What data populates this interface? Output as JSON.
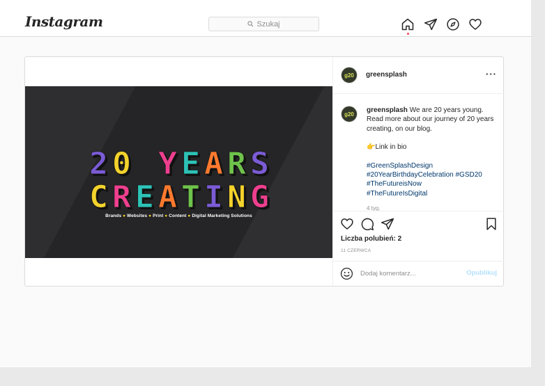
{
  "header": {
    "logo": "Instagram",
    "search": {
      "placeholder": "Szukaj"
    },
    "nav_icons": [
      "home-icon",
      "direct-icon",
      "explore-icon",
      "activity-icon"
    ]
  },
  "post": {
    "username": "greensplash",
    "avatar_text": "g20",
    "more_label": "···",
    "media": {
      "headline_line1": "20 YEARS",
      "headline_line2": "CREATING",
      "tagline_items": [
        "Brands",
        "Websites",
        "Print",
        "Content",
        "Digital Marketing Solutions"
      ],
      "letter_colors": [
        "#7b5bd6",
        "#f3d22b",
        "#ee3f8f",
        "#2cc3b7",
        "#ff7a2e",
        "#6fc24b"
      ]
    },
    "caption": {
      "username": "greensplash",
      "text": "We are 20 years young. Read more about our journey of 20 years creating, on our blog.",
      "link_line": "👉Link in bio",
      "hashtags": [
        "#GreenSplashDesign",
        "#20YearBirthdayCelebration #GSD20",
        "#TheFutureisNow",
        "#TheFutureIsDigital"
      ],
      "time_stub": "4 tyg."
    },
    "likes_label": "Liczba polubień: 2",
    "date": "11 CZERWCA",
    "comment": {
      "placeholder": "Dodaj komentarz...",
      "publish_label": "Opublikuj"
    },
    "accent_color": "#0095f6"
  }
}
